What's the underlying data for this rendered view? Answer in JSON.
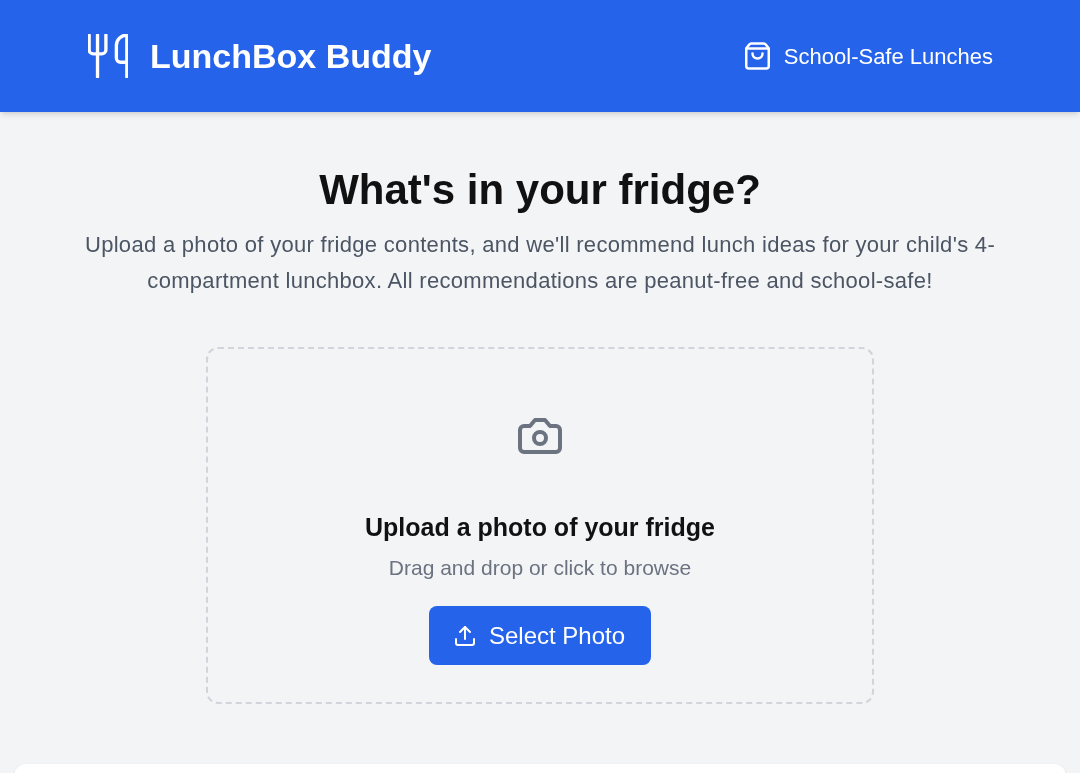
{
  "header": {
    "title": "LunchBox Buddy",
    "nav_link": "School-Safe Lunches"
  },
  "hero": {
    "heading": "What's in your fridge?",
    "description": "Upload a photo of your fridge contents, and we'll recommend lunch ideas for your child's 4-compartment lunchbox. All recommendations are peanut-free and school-safe!"
  },
  "upload": {
    "title": "Upload a photo of your fridge",
    "hint": "Drag and drop or click to browse",
    "button": "Select Photo"
  }
}
